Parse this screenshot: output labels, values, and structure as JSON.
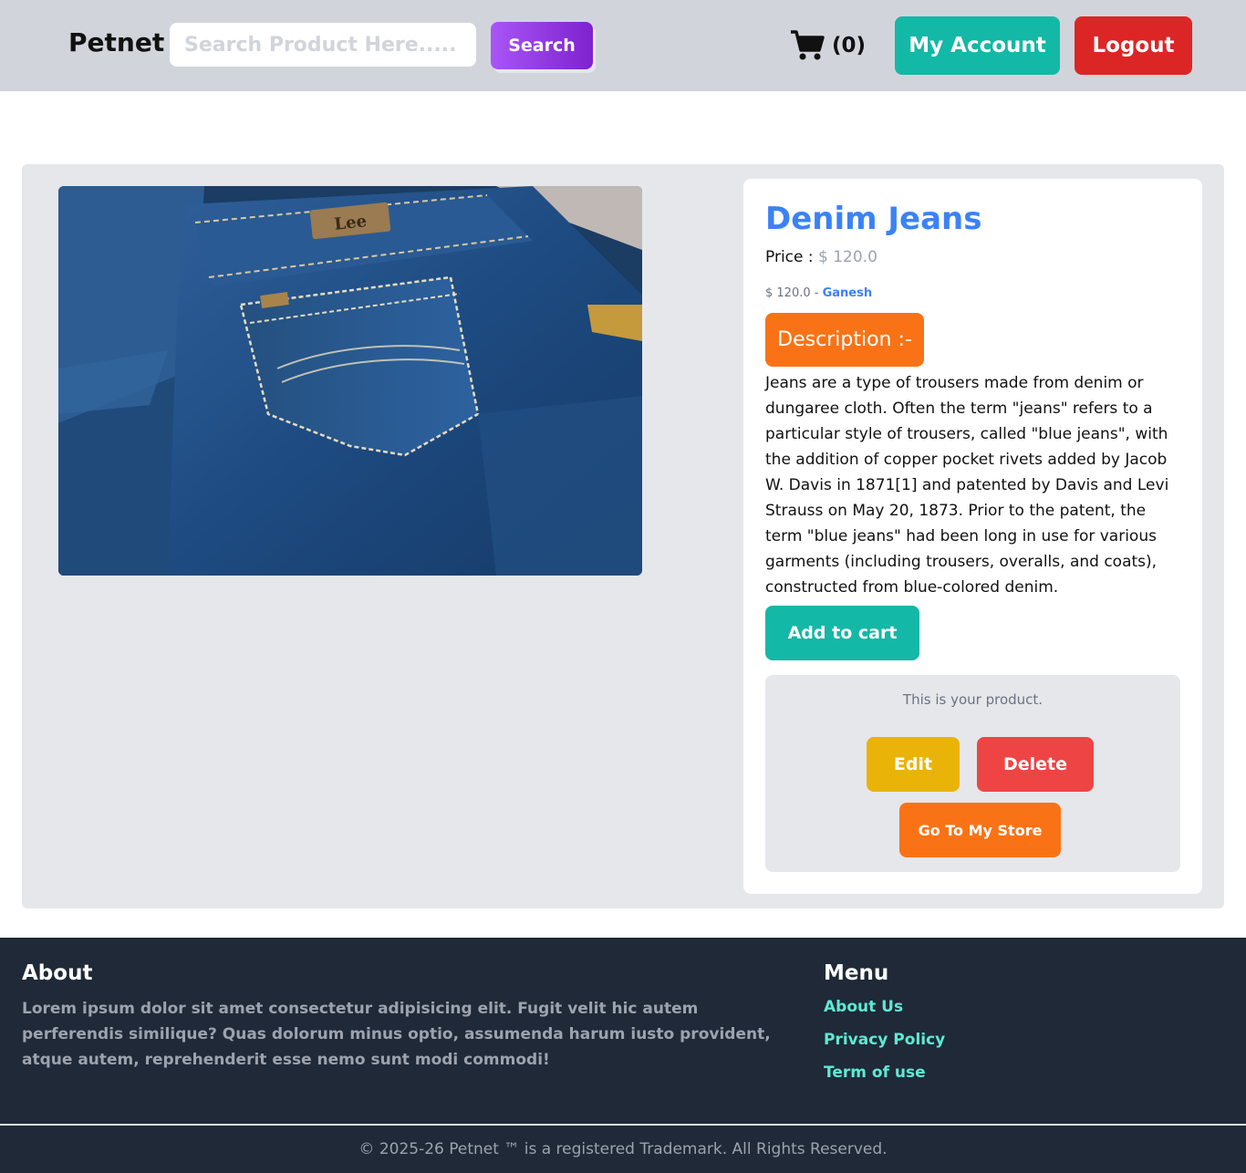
{
  "header": {
    "brand": "Petnet",
    "search_placeholder": "Search Product Here.....",
    "search_label": "Search",
    "cart_count": "(0)",
    "account_label": "My Account",
    "logout_label": "Logout"
  },
  "product": {
    "title": "Denim Jeans",
    "price_label": "Price : ",
    "price_value": "$ 120.0",
    "seller_price": "$ 120.0 - ",
    "seller_name": "Ganesh",
    "description_heading": "Description :-",
    "description": "Jeans are a type of trousers made from denim or dungaree cloth. Often the term \"jeans\" refers to a particular style of trousers, called \"blue jeans\", with the addition of copper pocket rivets added by Jacob W. Davis in 1871[1] and patented by Davis and Levi Strauss on May 20, 1873. Prior to the patent, the term \"blue jeans\" had been long in use for various garments (including trousers, overalls, and coats), constructed from blue-colored denim.",
    "add_to_cart_label": "Add to cart",
    "image_label": "Lee"
  },
  "owner": {
    "note": "This is your product.",
    "edit_label": "Edit",
    "delete_label": "Delete",
    "store_label": "Go To My Store"
  },
  "footer": {
    "about_title": "About",
    "about_text": "Lorem ipsum dolor sit amet consectetur adipisicing elit. Fugit velit hic autem perferendis similique? Quas dolorum minus optio, assumenda harum iusto provident, atque autem, reprehenderit esse nemo sunt modi commodi!",
    "menu_title": "Menu",
    "menu_items": [
      "About Us",
      "Privacy Policy",
      "Term of use"
    ],
    "copyright": "© 2025-26  Petnet ™ is a registered Trademark. All Rights Reserved."
  },
  "icons": {
    "cart": "shopping-cart-icon"
  },
  "colors": {
    "accent_teal": "#14b8a6",
    "danger_red": "#dc2626",
    "accent_orange": "#f97316",
    "title_blue": "#3b82f6",
    "search_purple": "#a855f7"
  }
}
